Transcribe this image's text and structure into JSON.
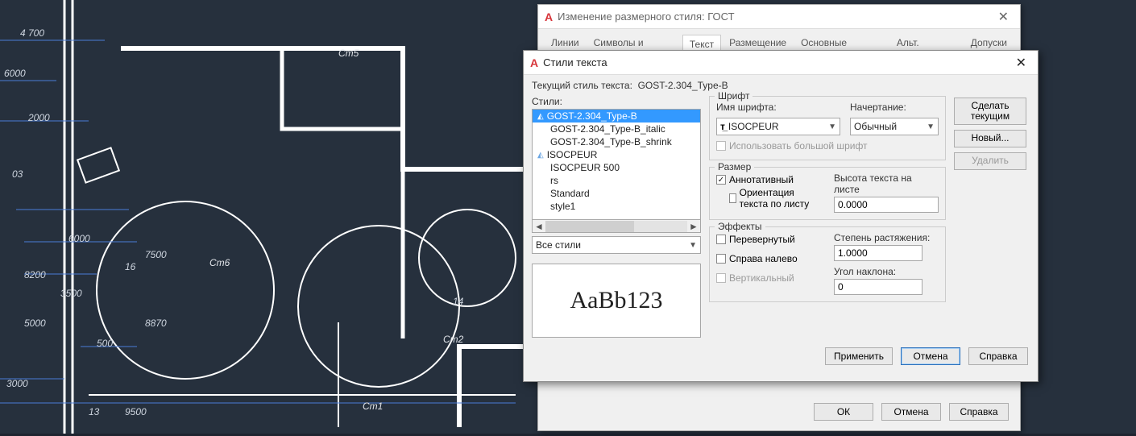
{
  "canvas": {
    "labels": [
      "Ст5",
      "Ст6",
      "Ст2",
      "Ст1"
    ],
    "dims": [
      "4 700",
      "6000",
      "2000",
      "6000",
      "3500",
      "7500",
      "5000",
      "3000",
      "500",
      "8870",
      "9500",
      "8200",
      "16",
      "14",
      "03",
      "13"
    ]
  },
  "dimDlg": {
    "title": "Изменение размерного стиля: ГОСТ",
    "tabs": [
      "Линии",
      "Символы и стрелки",
      "Текст",
      "Размещение",
      "Основные единицы",
      "Альт. единицы",
      "Допуски"
    ],
    "activeTab": "Текст",
    "btn_ok": "ОК",
    "btn_cancel": "Отмена",
    "btn_help": "Справка"
  },
  "txtDlg": {
    "title": "Стили текста",
    "currentLabel": "Текущий стиль текста:",
    "currentValue": "GOST-2.304_Type-B",
    "stylesLabel": "Стили:",
    "styles": [
      "GOST-2.304_Type-B",
      "GOST-2.304_Type-B_italic",
      "GOST-2.304_Type-B_shrink",
      "ISOCPEUR",
      "ISOCPEUR 500",
      "rs",
      "Standard",
      "style1"
    ],
    "selectedStyle": "GOST-2.304_Type-B",
    "filterCombo": "Все стили",
    "preview": "AaBb123",
    "font": {
      "legend": "Шрифт",
      "nameLabel": "Имя шрифта:",
      "nameValue": "ISOCPEUR",
      "styleLabel": "Начертание:",
      "styleValue": "Обычный",
      "bigFontChk": "Использовать большой шрифт"
    },
    "size": {
      "legend": "Размер",
      "annotative": "Аннотативный",
      "orient": "Ориентация текста по листу",
      "heightLabel": "Высота текста на листе",
      "heightValue": "0.0000"
    },
    "effects": {
      "legend": "Эффекты",
      "upside": "Перевернутый",
      "rtl": "Справа налево",
      "vertical": "Вертикальный",
      "widthLabel": "Степень растяжения:",
      "widthValue": "1.0000",
      "obliqueLabel": "Угол наклона:",
      "obliqueValue": "0"
    },
    "btn_setcur": "Сделать текущим",
    "btn_new": "Новый...",
    "btn_delete": "Удалить",
    "btn_apply": "Применить",
    "btn_cancel": "Отмена",
    "btn_help": "Справка"
  }
}
